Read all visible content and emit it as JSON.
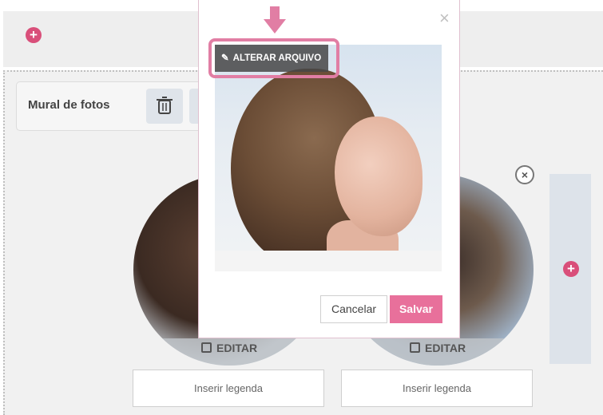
{
  "background": {
    "card_title": "Mural de fotos",
    "edit_label": "EDITAR",
    "caption_placeholder": "Inserir legenda",
    "add_icon": "plus-icon",
    "delete_icon": "trash-icon"
  },
  "modal": {
    "change_file_label": "ALTERAR ARQUIVO",
    "cancel_label": "Cancelar",
    "save_label": "Salvar",
    "close_glyph": "×"
  },
  "colors": {
    "accent": "#e8709b",
    "highlight": "#e17ea4",
    "add_button": "#d94f7a"
  }
}
